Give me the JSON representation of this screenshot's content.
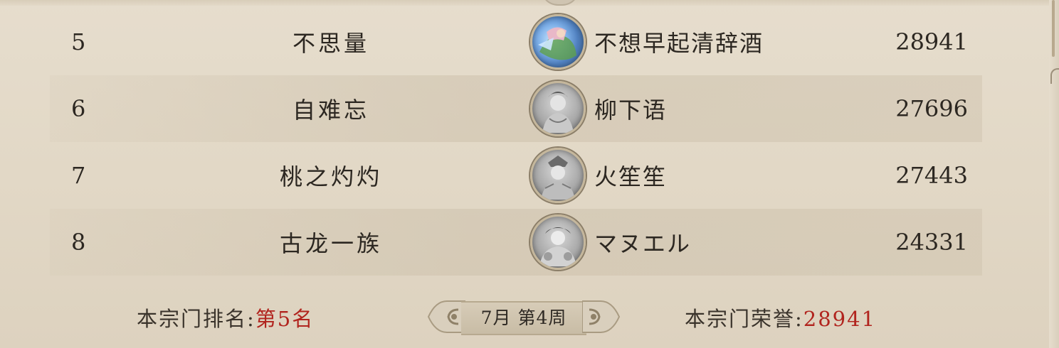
{
  "leaderboard": {
    "rows": [
      {
        "rank": "5",
        "sect": "不思量",
        "player": "不想早起清辞酒",
        "score": "28941",
        "avatar_icon": "character-portrait-color-icon"
      },
      {
        "rank": "6",
        "sect": "自难忘",
        "player": "柳下语",
        "score": "27696",
        "avatar_icon": "character-portrait-icon"
      },
      {
        "rank": "7",
        "sect": "桃之灼灼",
        "player": "火笙笙",
        "score": "27443",
        "avatar_icon": "character-portrait-icon"
      },
      {
        "rank": "8",
        "sect": "古龙一族",
        "player": "マヌエル",
        "score": "24331",
        "avatar_icon": "character-portrait-icon"
      }
    ]
  },
  "footer": {
    "sect_rank_label": "本宗门排名:",
    "sect_rank_value": "第5名",
    "week_label": "7月 第4周",
    "sect_honor_label": "本宗门荣誉:",
    "sect_honor_value": "28941"
  },
  "colors": {
    "background": "#e2d8c6",
    "text": "#2c2721",
    "highlight": "#b1241e"
  }
}
